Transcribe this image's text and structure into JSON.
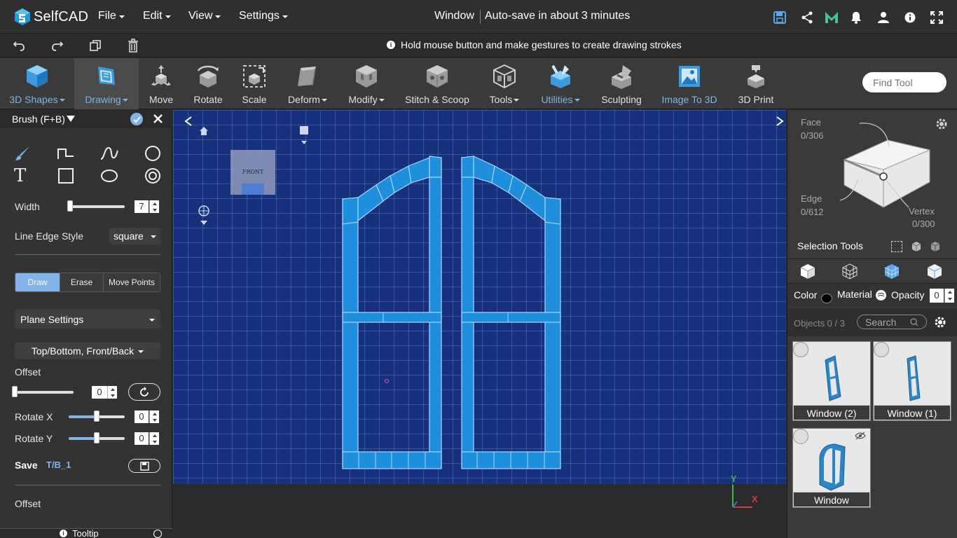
{
  "app": {
    "name": "SelfCAD"
  },
  "menu": [
    {
      "label": "File"
    },
    {
      "label": "Edit"
    },
    {
      "label": "View"
    },
    {
      "label": "Settings"
    }
  ],
  "document": {
    "title": "Window",
    "autosave": "Auto-save in about 3 minutes"
  },
  "hint": "Hold mouse button and make gestures to create drawing strokes",
  "tools": [
    {
      "label": "3D Shapes",
      "dropdown": true
    },
    {
      "label": "Drawing",
      "dropdown": true
    },
    {
      "label": "Move"
    },
    {
      "label": "Rotate"
    },
    {
      "label": "Scale"
    },
    {
      "label": "Deform",
      "dropdown": true
    },
    {
      "label": "Modify",
      "dropdown": true
    },
    {
      "label": "Stitch & Scoop"
    },
    {
      "label": "Tools",
      "dropdown": true
    },
    {
      "label": "Utilities",
      "dropdown": true
    },
    {
      "label": "Sculpting"
    },
    {
      "label": "Image To 3D"
    },
    {
      "label": "3D Print"
    }
  ],
  "find_tool": {
    "placeholder": "Find Tool"
  },
  "panel": {
    "title": "Brush (F+B)",
    "width_label": "Width",
    "width_value": "7",
    "width_level": 0.0,
    "edge_label": "Line Edge Style",
    "edge_value": "square",
    "modes": [
      "Draw",
      "Erase",
      "Move Points"
    ],
    "active_mode": "Draw",
    "plane_settings": "Plane Settings",
    "plane_option": "Top/Bottom, Front/Back",
    "offset_label": "Offset",
    "offset_value": "0",
    "offset_level": 0.0,
    "rotx_label": "Rotate X",
    "rotx_value": "0",
    "rotx_level": 0.5,
    "roty_label": "Rotate Y",
    "roty_value": "0",
    "roty_level": 0.5,
    "save_label": "Save",
    "save_name": "T/B_1",
    "offset2_label": "Offset",
    "tooltip_label": "Tooltip"
  },
  "viewport": {
    "cube_label": "FRONT",
    "axis_y": "Y",
    "axis_x": "X"
  },
  "selection": {
    "face_label": "Face",
    "face_count": "0/306",
    "edge_label": "Edge",
    "edge_count": "0/612",
    "vertex_label": "Vertex",
    "vertex_count": "0/300",
    "tools_label": "Selection Tools"
  },
  "props": {
    "color_label": "Color",
    "material_label": "Material",
    "opacity_label": "Opacity",
    "opacity_value": "0"
  },
  "objects": {
    "count_label": "Objects 0 / 3",
    "search_placeholder": "Search",
    "items": [
      {
        "name": "Window (2)"
      },
      {
        "name": "Window (1)"
      },
      {
        "name": "Window"
      }
    ]
  },
  "colors": {
    "accent": "#7fb3ea",
    "viewport_bg": "#17317d",
    "model": "#1e8fdc"
  }
}
